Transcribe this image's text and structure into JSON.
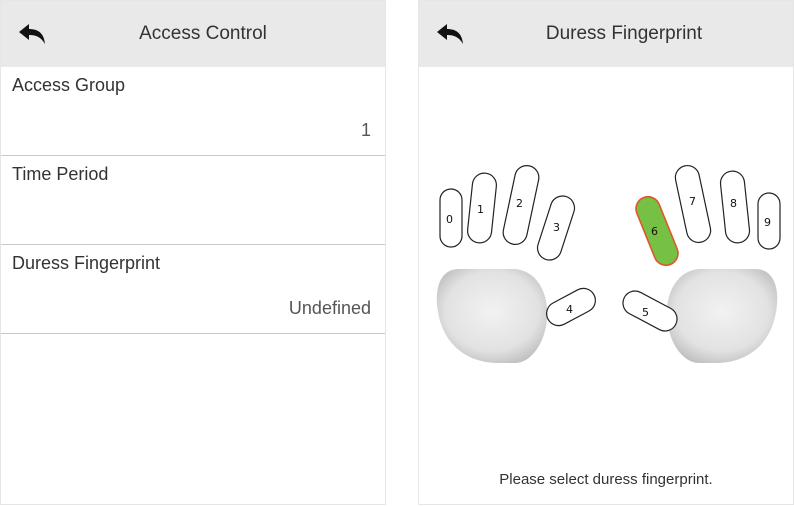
{
  "left": {
    "title": "Access Control",
    "items": [
      {
        "label": "Access Group",
        "value": "1"
      },
      {
        "label": "Time Period",
        "value": ""
      },
      {
        "label": "Duress Fingerprint",
        "value": "Undefined"
      }
    ]
  },
  "right": {
    "title": "Duress Fingerprint",
    "fingers": [
      "0",
      "1",
      "2",
      "3",
      "4",
      "5",
      "6",
      "7",
      "8",
      "9"
    ],
    "selected_finger": "6",
    "prompt": "Please select duress fingerprint."
  },
  "colors": {
    "header_bg": "#e9e9e9",
    "selected_fill": "#76c043",
    "selected_stroke": "#e0552c",
    "palm_fill": "#dcdcdc"
  },
  "icons": {
    "back": "back-arrow-icon"
  }
}
